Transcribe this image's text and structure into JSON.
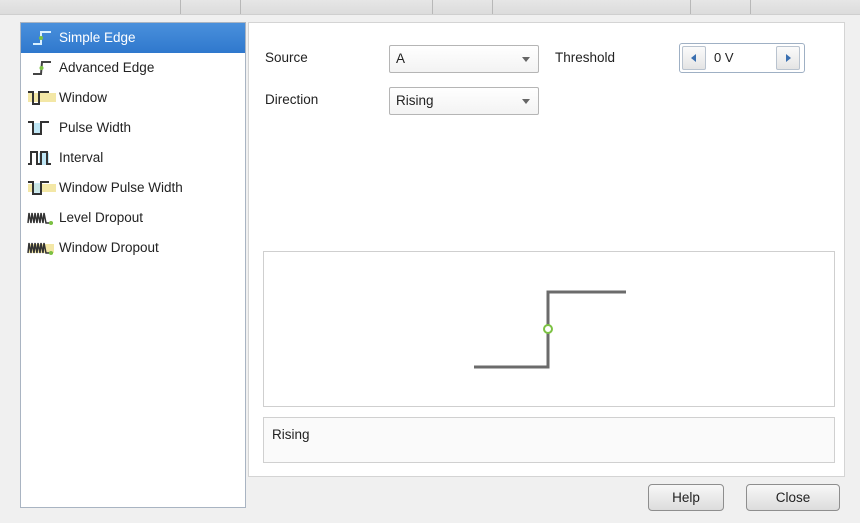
{
  "trigger_types": [
    {
      "label": "Simple Edge",
      "icon": "simple-edge-icon",
      "selected": true
    },
    {
      "label": "Advanced Edge",
      "icon": "advanced-edge-icon",
      "selected": false
    },
    {
      "label": "Window",
      "icon": "window-icon",
      "selected": false
    },
    {
      "label": "Pulse Width",
      "icon": "pulse-width-icon",
      "selected": false
    },
    {
      "label": "Interval",
      "icon": "interval-icon",
      "selected": false
    },
    {
      "label": "Window Pulse Width",
      "icon": "window-pulse-width-icon",
      "selected": false
    },
    {
      "label": "Level Dropout",
      "icon": "level-dropout-icon",
      "selected": false
    },
    {
      "label": "Window Dropout",
      "icon": "window-dropout-icon",
      "selected": false
    }
  ],
  "settings": {
    "source_label": "Source",
    "source_value": "A",
    "direction_label": "Direction",
    "direction_value": "Rising",
    "threshold_label": "Threshold",
    "threshold_value": "0 V"
  },
  "description": "Rising",
  "buttons": {
    "help": "Help",
    "close": "Close"
  },
  "colors": {
    "selection": "#2f78cd",
    "waveform": "#6b6b6b",
    "trigger_point": "#7cc243"
  }
}
